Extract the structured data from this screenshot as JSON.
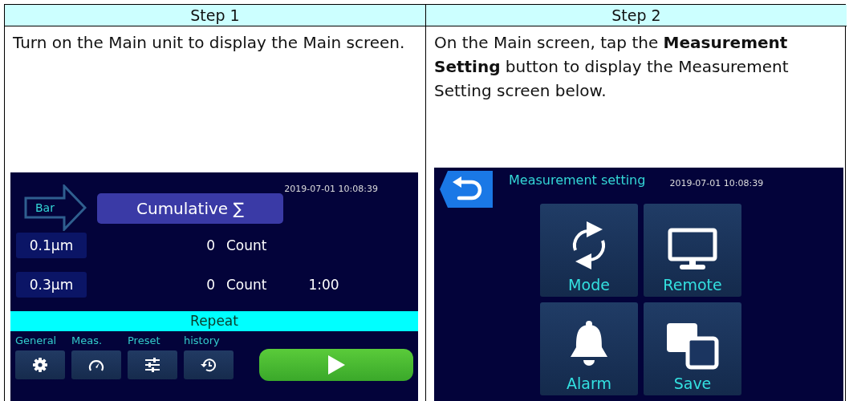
{
  "steps": [
    {
      "heading": "Step 1",
      "text": "Turn on the Main unit to display the Main screen.",
      "screen": {
        "kind": "main",
        "datetime": "2019-07-01 10:08:39",
        "mode_arrow": "Bar",
        "mode_button": "Cumulative ∑",
        "rows": [
          {
            "size": "0.1µm",
            "value": "0",
            "unit": "Count"
          },
          {
            "size": "0.3µm",
            "value": "0",
            "unit": "Count",
            "timer": "1:00"
          }
        ],
        "repeat_bar": "Repeat",
        "menu": [
          {
            "label": "General",
            "kind": "gear"
          },
          {
            "label": "Meas.",
            "kind": "gauge"
          },
          {
            "label": "Preset",
            "kind": "sliders"
          },
          {
            "label": "history",
            "kind": "history"
          }
        ]
      }
    },
    {
      "heading": "Step 2",
      "text": "On the Main screen, tap the **Measurement Setting** button to display the Measurement Setting screen below.",
      "screen": {
        "kind": "settings",
        "title": "Measurement setting",
        "datetime": "2019-07-01 10:08:39",
        "tiles": [
          {
            "label": "Mode",
            "kind": "cycle"
          },
          {
            "label": "Remote",
            "kind": "monitor"
          },
          {
            "label": "Alarm",
            "kind": "bell"
          },
          {
            "label": "Save",
            "kind": "copy"
          }
        ]
      }
    }
  ]
}
